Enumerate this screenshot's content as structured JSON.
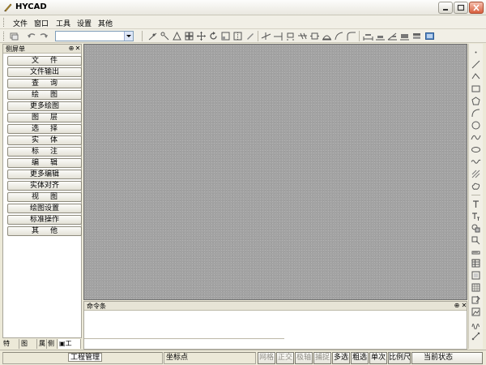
{
  "window": {
    "title": "HYCAD"
  },
  "menu": {
    "items": [
      "文件",
      "窗口",
      "工具",
      "设置",
      "其他"
    ]
  },
  "toolbar": {
    "layer_value": ""
  },
  "left_panel": {
    "title": "侧屏单",
    "buttons": [
      "文件",
      "文件输出",
      "查询",
      "绘图",
      "更多绘图",
      "图层",
      "选择",
      "实体",
      "标注",
      "编辑",
      "更多编辑",
      "实体对齐",
      "视图",
      "绘图设置",
      "标准操作",
      "其他"
    ],
    "tabs": [
      "特",
      "图",
      "属",
      "侧",
      "工"
    ]
  },
  "command_panel": {
    "title": "命令条"
  },
  "status": {
    "management": "工程管理",
    "coordinate": "坐标点",
    "toggles": [
      {
        "label": "网格",
        "on": false
      },
      {
        "label": "正交",
        "on": false
      },
      {
        "label": "极轴",
        "on": false
      },
      {
        "label": "捕捉",
        "on": false
      },
      {
        "label": "多选",
        "on": true
      },
      {
        "label": "粗选",
        "on": true
      },
      {
        "label": "单次",
        "on": true
      },
      {
        "label": "比例尺",
        "on": true
      },
      {
        "label": "当前状态",
        "on": true
      }
    ]
  },
  "colors": {
    "canvas": "#a3a3a3",
    "chrome": "#ece9d8",
    "close": "#d85e3d"
  }
}
